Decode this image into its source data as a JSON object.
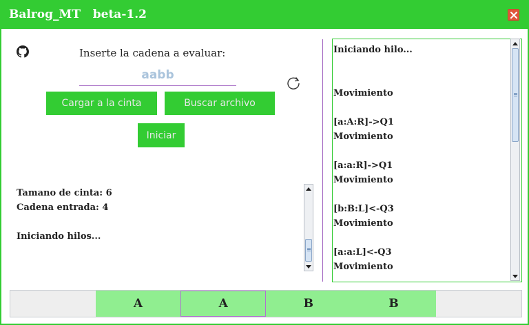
{
  "window": {
    "title": "Balrog_MT   beta-1.2",
    "accent_color": "#33cc33",
    "close_icon": "close-icon"
  },
  "input_panel": {
    "prompt": "Inserte la cadena a evaluar:",
    "input_value": "aabb",
    "buttons": {
      "load": "Cargar a la cinta",
      "search_file": "Buscar archivo",
      "start": "Iniciar"
    },
    "icons": [
      "github-icon",
      "refresh-icon"
    ]
  },
  "left_log": [
    "Tamano de cinta: 6",
    "Cadena entrada: 4",
    "",
    "Iniciando hilos..."
  ],
  "right_log": [
    "Iniciando hilo...",
    "",
    "",
    "Movimiento",
    "",
    "[a:A:R]->Q1",
    "Movimiento",
    "",
    "[a:a:R]->Q1",
    "Movimiento",
    "",
    "[b:B:L]<-Q3",
    "Movimiento",
    "",
    "[a:a:L]<-Q3",
    "Movimiento"
  ],
  "tape": {
    "cells": [
      "",
      "A",
      "A",
      "B",
      "B",
      ""
    ],
    "head_index": 2,
    "filled_color": "#90ee90",
    "empty_color": "#eeeeee"
  }
}
